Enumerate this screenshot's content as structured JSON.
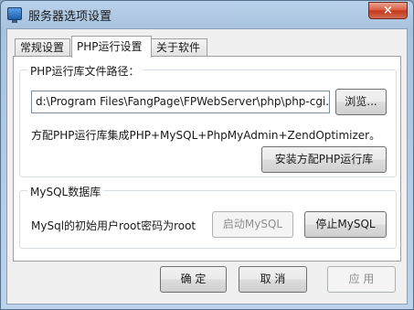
{
  "window": {
    "title": "服务器选项设置",
    "close_label": "×"
  },
  "tabs": [
    {
      "label": "常规设置",
      "active": false
    },
    {
      "label": "PHP运行设置",
      "active": true
    },
    {
      "label": "关于软件",
      "active": false
    }
  ],
  "php_group": {
    "legend": "PHP运行库文件路径：",
    "path_value": "d:\\Program Files\\FangPage\\FPWebServer\\php\\php-cgi.exe",
    "browse_label": "浏览...",
    "description": "方配PHP运行库集成PHP+MySQL+PhpMyAdmin+ZendOptimizer。",
    "install_label": "安装方配PHP运行库"
  },
  "mysql_group": {
    "legend": "MySQL数据库",
    "description": "MySql的初始用户root密码为root",
    "start_label": "启动MySQL",
    "stop_label": "停止MySQL"
  },
  "footer": {
    "ok_label": "确 定",
    "cancel_label": "取 消",
    "apply_label": "应 用"
  }
}
